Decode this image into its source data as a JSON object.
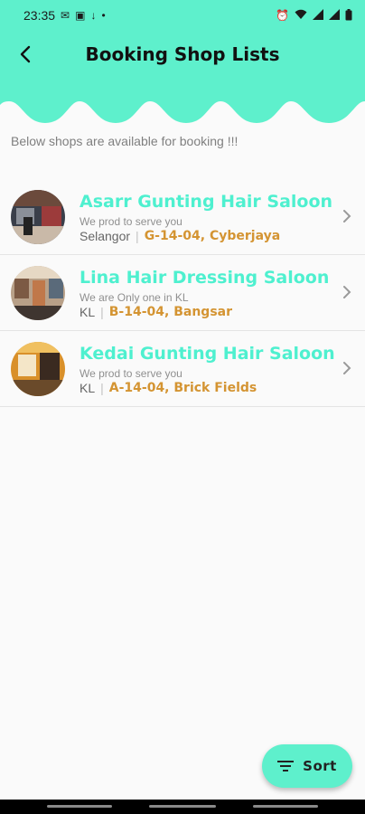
{
  "status_bar": {
    "time": "23:35",
    "left_icons": [
      "mail-icon",
      "image-icon",
      "download-icon",
      "dot-icon"
    ],
    "right_icons": [
      "alarm-icon",
      "wifi-icon",
      "signal-icon",
      "signal-icon",
      "battery-icon"
    ]
  },
  "header": {
    "title": "Booking Shop Lists",
    "color": "#5ef0cc"
  },
  "subtitle": "Below shops are available for booking !!!",
  "shops": [
    {
      "name": "Asarr Gunting Hair Saloon",
      "tagline": "We prod to serve you",
      "state": "Selangor",
      "address": "G-14-04, Cyberjaya"
    },
    {
      "name": "Lina Hair Dressing Saloon",
      "tagline": "We are Only one in KL",
      "state": "KL",
      "address": "B-14-04, Bangsar"
    },
    {
      "name": "Kedai Gunting Hair Saloon",
      "tagline": "We prod to serve you",
      "state": "KL",
      "address": "A-14-04, Brick Fields"
    }
  ],
  "sort_button": {
    "label": "Sort"
  },
  "colors": {
    "accent": "#5ef0cc",
    "shop_name": "#4ef0cf",
    "address": "#d49432"
  }
}
